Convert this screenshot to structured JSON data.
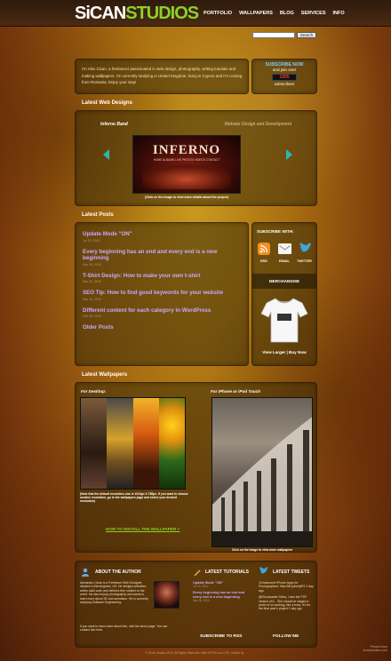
{
  "logo": {
    "part1": "SiCAN",
    "part2": "STUDIOS"
  },
  "nav": [
    "PORTFOLIO",
    "WALLPAPERS",
    "BLOG",
    "SERVICES",
    "INFO"
  ],
  "search": {
    "button": "Search"
  },
  "intro": "I'm Alex Cican, a freelancer passionated in web design, photography, writing tutorials and making wallpapers. I'm currently studying in United Kingdom, living in Cyprus and I'm coming from Romania. Enjoy your stay!",
  "subscribe": {
    "line1": "SUBSCRIBE NOW",
    "line2": "and join over",
    "count": "1895",
    "line3": "subscribers"
  },
  "latest_web_designs": {
    "title": "Latest Web Designs",
    "project": "Inferno Band",
    "category": "Website Design and Development",
    "image_text": "INFERNO",
    "image_menu": "HOME ALBUMS LIVE PHOTOS VIDEOS CONTACT",
    "caption": "(Click on the image to view more details about the project)"
  },
  "latest_posts": {
    "title": "Latest Posts",
    "posts": [
      {
        "title": "Update Mode \"ON\"",
        "date": "Jul 19, 2010"
      },
      {
        "title": "Every beginning has an end and every end is a new beginning",
        "date": "Mar 26, 2010"
      },
      {
        "title": "T-Shirt Design: How to make your own t-shirt",
        "date": "Mar 22, 2010"
      },
      {
        "title": "SEO Tip: How to find good keywords for your website",
        "date": "Mar 14, 2010"
      },
      {
        "title": "Different content for each category in WordPress",
        "date": "Feb 26, 2010"
      }
    ],
    "older": "Older Posts"
  },
  "subscribe_with": {
    "title": "SUBSCRIBE WITH:",
    "rss": "RSS",
    "email": "EMAIL",
    "twitter": "TWITTER",
    "merch_title": "MERCHANDISE",
    "merch_link": "View Larger | Buy Now"
  },
  "wallpapers": {
    "title": "Latest Wallpapers",
    "desktop": "For Desktop:",
    "mobile": "For iPhone or iPod Touch",
    "desktop_note": "(Note that the default resolution size is 1024px X 768px. If you want to choose another resolution, go to the wallpapers page and select your desired resolution)",
    "install": "HOW TO INSTALL THE WALLPAPER ?",
    "mobile_caption": "Click on the image to view more wallpapers"
  },
  "footer": {
    "about_title": "ABOUT THE AUTHOR",
    "about_text": "Alexandru Cican is a Freelance Web Designer, situated in Birmingham, UK. He designs websites, writes valid code and delivers free content to the world. He also enjoys photography and wants to learn more about 3D and animation. He is currently studying Software Engineering.",
    "about_more": "If you want to learn more about him, visit the about page. You can contact him here.",
    "tutorials_title": "LATEST TUTORIALS",
    "tutorials": [
      {
        "title": "Update Mode \"ON\"",
        "date": "Jul 19, 2010"
      },
      {
        "title": "Every beginning has an end and every end is a new beginning",
        "date": "Mar 26, 2010"
      }
    ],
    "tweets_title": "LATEST TWEETS",
    "tweets": [
      "10 Awesome iPhone Apps for Photographers: http://bit.ly/bchjkF6 1 day ago",
      "@DrLancaster Haha, I saw the PSP version of it... She should've staged a photo of us working, like a boss. It's for the final year's project 1 day ago"
    ],
    "rss_link": "SUBSCRIBE TO RSS",
    "follow_link": "FOLLOW ME",
    "copyright": "© SiCan Studios 2010. All Rights Reserved. Valid XHTML and CSS. Hosted by ...",
    "watermark1": "Pinned from",
    "watermark2": "sicanstudios.com"
  },
  "colors": {
    "accent_green": "#8ed02a",
    "link_purple": "#c9a8ff",
    "subscribe_red": "#e03a2a"
  }
}
